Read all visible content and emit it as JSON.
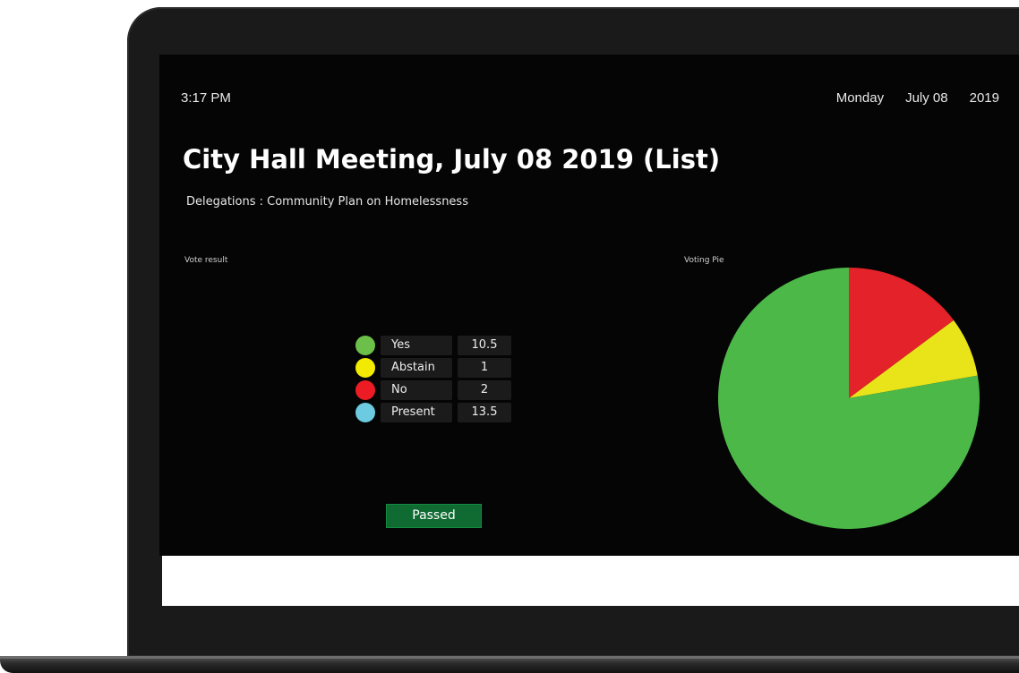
{
  "header": {
    "time": "3:17 PM",
    "day": "Monday",
    "date": "July 08",
    "year": "2019"
  },
  "meeting": {
    "title": "City Hall Meeting, July 08 2019 (List)",
    "subtitle": "Delegations : Community Plan on Homelessness"
  },
  "vote_result": {
    "label": "Vote result",
    "rows": [
      {
        "label": "Yes",
        "value": "10.5",
        "color": "#6cc04a"
      },
      {
        "label": "Abstain",
        "value": "1",
        "color": "#f2ea00"
      },
      {
        "label": "No",
        "value": "2",
        "color": "#ed1c24"
      },
      {
        "label": "Present",
        "value": "13.5",
        "color": "#6ccbe0"
      }
    ],
    "status": "Passed",
    "status_color": "#0f6b32"
  },
  "pie": {
    "label": "Voting Pie"
  },
  "chart_data": {
    "type": "pie",
    "categories": [
      "Yes",
      "Abstain",
      "No"
    ],
    "values": [
      10.5,
      1,
      2
    ],
    "colors": [
      "#4cb848",
      "#e9e41a",
      "#e3222a"
    ]
  }
}
